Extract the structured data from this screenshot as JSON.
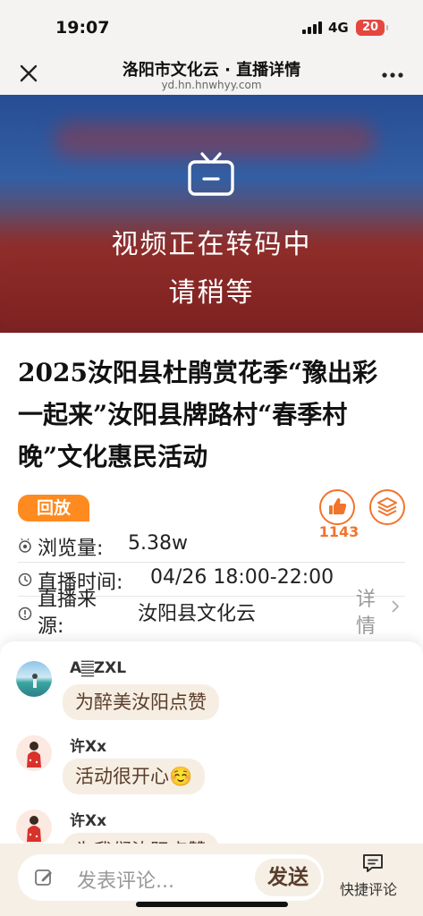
{
  "status": {
    "time": "19:07",
    "network": "4G",
    "battery": "20"
  },
  "nav": {
    "title": "洛阳市文化云 · 直播详情",
    "url": "yd.hn.hnwhyy.com",
    "close_icon": "close-icon",
    "more_icon": "more-icon"
  },
  "video": {
    "icon": "tv-icon",
    "line1": "视频正在转码中",
    "line2": "请稍等"
  },
  "event": {
    "title": "2025汝阳县杜鹃赏花季“豫出彩 一起来”汝阳县牌路村“春季村晚”文化惠民活动",
    "tag": "回放",
    "likes": "1143",
    "views_label": "浏览量:",
    "views_value": "5.38w",
    "time_label": "直播时间:",
    "time_value": "04/26 18:00-22:00",
    "source_label": "直播来源:",
    "source_value": "汝阳县文化云",
    "detail_label": "详情"
  },
  "comments": [
    {
      "name": "A𝄛ZXL",
      "text": "为醉美汝阳点赞"
    },
    {
      "name": "许Xx",
      "text": "活动很开心☺️"
    },
    {
      "name": "许Xx",
      "text": "为我们汝阳点赞"
    }
  ],
  "bottom": {
    "placeholder": "发表评论...",
    "send": "发送",
    "quick": "快捷评论"
  },
  "colors": {
    "accent": "#ff8a1f",
    "like": "#f2732c",
    "bubble": "#f6eee2"
  }
}
